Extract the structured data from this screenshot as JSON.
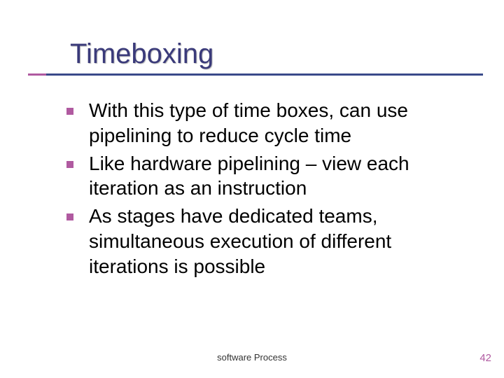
{
  "title": "Timeboxing",
  "bullets": [
    "With this type of time boxes, can use pipelining to reduce cycle time",
    "Like hardware pipelining – view each iteration as an instruction",
    "As stages have dedicated teams, simultaneous execution of different iterations is possible"
  ],
  "footer": "software Process",
  "page_number": "42",
  "colors": {
    "accent": "#b05aa0",
    "title": "#3a3a7a",
    "rule": "#3a4a8a"
  }
}
